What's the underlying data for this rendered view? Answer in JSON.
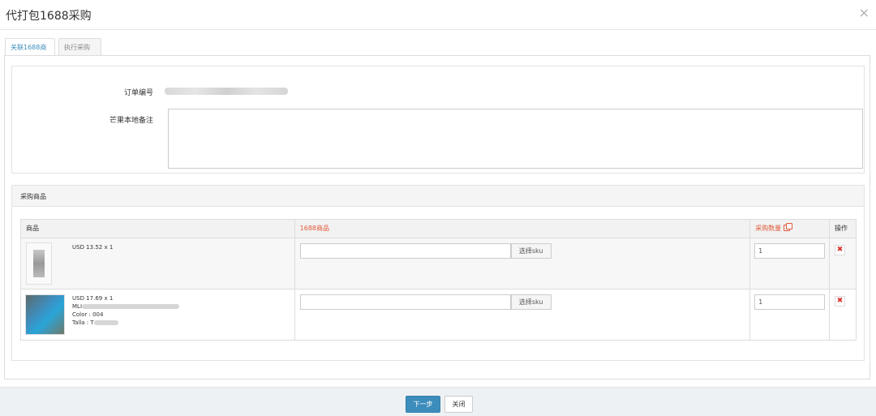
{
  "modal": {
    "title": "代打包1688采购",
    "close_icon": "×"
  },
  "tabs": [
    {
      "label": "关联1688商品",
      "active": true
    },
    {
      "label": "执行采购",
      "active": false
    }
  ],
  "order_section": {
    "order_no_label": "订单编号",
    "remark_label": "芒果本地备注",
    "remark_value": ""
  },
  "items_section": {
    "title": "采购商品",
    "columns": {
      "product": "商品",
      "product1688": "1688商品",
      "qty": "采购数量",
      "action": "操作"
    },
    "rows": [
      {
        "price_line": "USD 13.52 x 1",
        "details": [],
        "sku_button": "选择sku",
        "qty": "1"
      },
      {
        "price_line": "USD 17.69 x 1",
        "details": [
          "MLI",
          "Color : 004",
          "Talla : T"
        ],
        "sku_button": "选择sku",
        "qty": "1"
      }
    ]
  },
  "footer": {
    "next_label": "下一步",
    "close_label": "关闭"
  },
  "colors": {
    "accent": "#3c8dbc",
    "red_header": "#e05a3a",
    "delete": "#d9342b"
  }
}
